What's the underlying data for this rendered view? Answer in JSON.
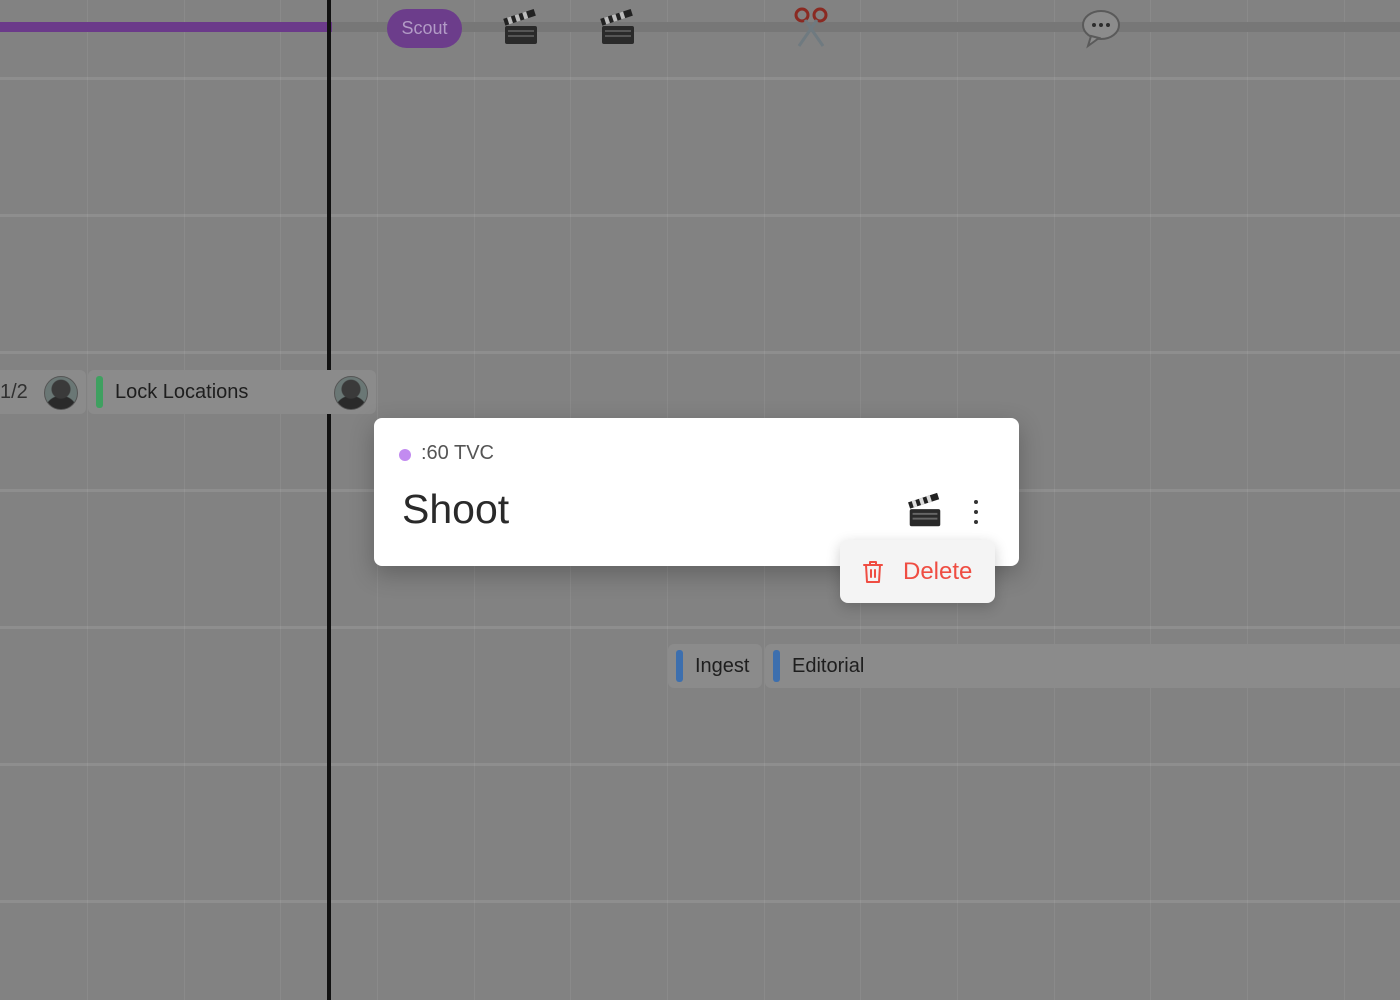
{
  "header": {
    "phase_pill": "Scout",
    "markers": [
      {
        "icon": "clapperboard-icon"
      },
      {
        "icon": "clapperboard-icon"
      },
      {
        "icon": "scissors-icon"
      },
      {
        "icon": "speech-bubble-icon"
      }
    ]
  },
  "rows": {
    "partial_task_text": "1/2",
    "lock_locations": {
      "label": "Lock Locations",
      "accent": "#3fa060"
    },
    "ingest": {
      "label": "Ingest",
      "accent": "#3d6fae"
    },
    "editorial": {
      "label": "Editorial",
      "accent": "#3d6fae"
    }
  },
  "popup": {
    "project": {
      "name": ":60 TVC",
      "color": "#c28bf0"
    },
    "title": "Shoot",
    "icon": "clapperboard-icon",
    "more_icon": "more-vertical-icon"
  },
  "context_menu": {
    "items": [
      {
        "label": "Delete",
        "icon": "trash-icon",
        "color": "#ef4d42"
      }
    ]
  },
  "colors": {
    "overlay_background": "#828282",
    "phase_bar": "#6b3a8a",
    "today_line": "#111111"
  }
}
